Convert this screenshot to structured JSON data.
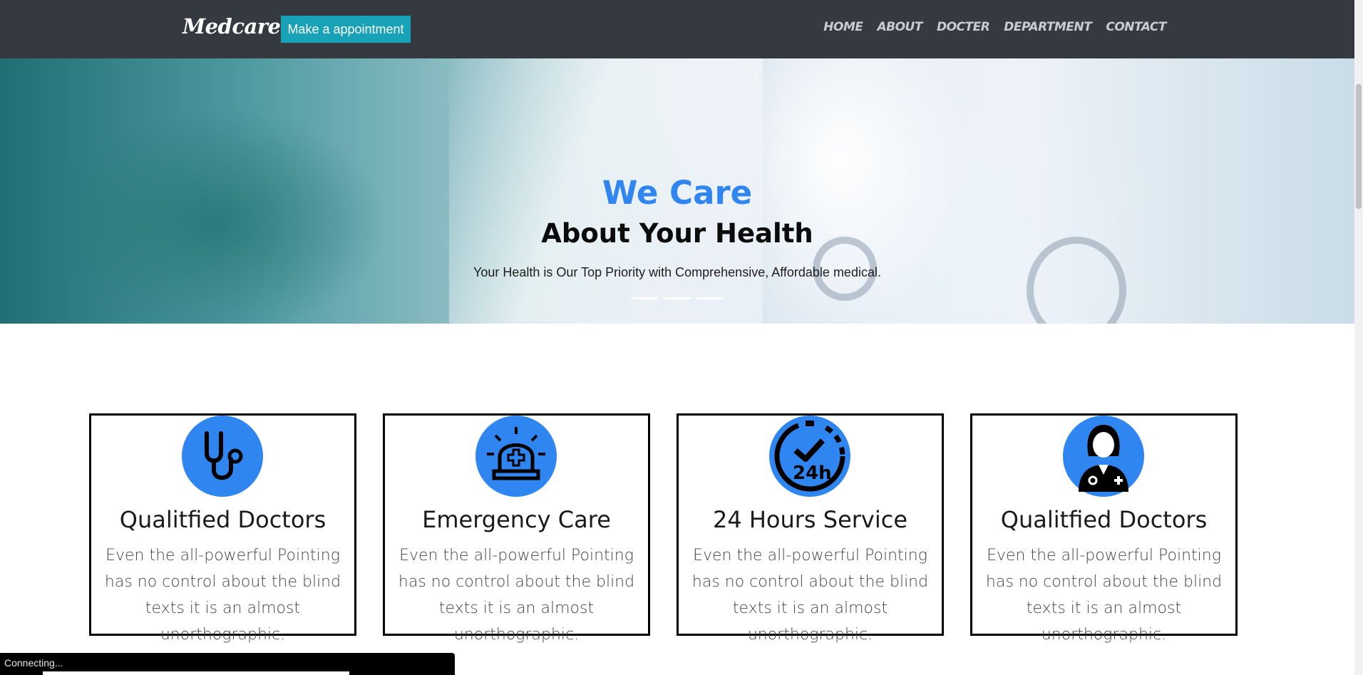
{
  "navbar": {
    "brand": "Medcare",
    "appointment_label": "Make a appointment",
    "links": [
      "HOME",
      "ABOUT",
      "DOCTER",
      "DEPARTMENT",
      "CONTACT"
    ]
  },
  "hero": {
    "title_line1": "We Care",
    "title_line2": "About Your Health",
    "subtitle": "Your Health is Our Top Priority with Comprehensive, Affordable medical.",
    "slides": 3
  },
  "features": [
    {
      "icon": "stethoscope-icon",
      "title": "Qualitfied Doctors",
      "text": "Even the all-powerful Pointing has no control about the blind texts it is an almost unorthographic."
    },
    {
      "icon": "emergency-light-icon",
      "title": "Emergency Care",
      "text": "Even the all-powerful Pointing has no control about the blind texts it is an almost unorthographic."
    },
    {
      "icon": "24-hours-icon",
      "title": "24 Hours Service",
      "text": "Even the all-powerful Pointing has no control about the blind texts it is an almost unorthographic."
    },
    {
      "icon": "female-doctor-icon",
      "title": "Qualitfied Doctors",
      "text": "Even the all-powerful Pointing has no control about the blind texts it is an almost unorthographic."
    }
  ],
  "status": {
    "text": "Connecting..."
  },
  "colors": {
    "navbar_bg": "#343a40",
    "accent_blue": "#2f86f0",
    "button_teal": "#17a2b8"
  }
}
